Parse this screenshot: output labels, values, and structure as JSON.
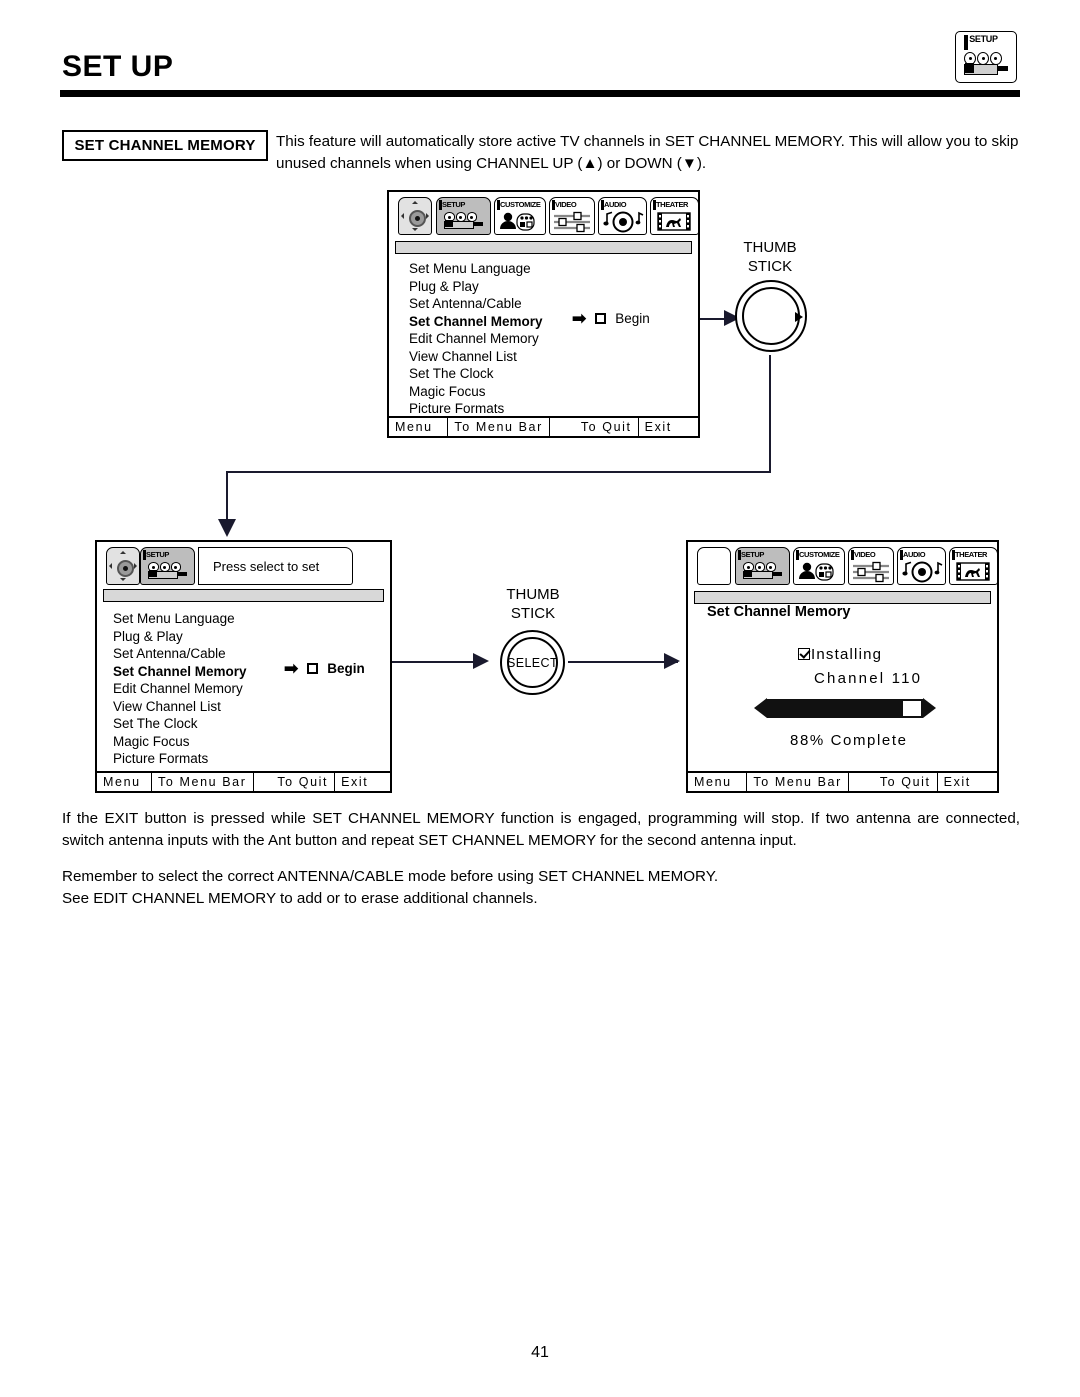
{
  "page": {
    "title": "SET UP",
    "number": "41",
    "corner_badge_icon": "setup-camera-icon"
  },
  "intro": {
    "label": "SET CHANNEL MEMORY",
    "text": "This feature will automatically store active TV channels in SET CHANNEL MEMORY.  This will allow you to skip unused channels when using CHANNEL UP (▲) or DOWN (▼)."
  },
  "tabs": [
    {
      "label": "SETUP",
      "icon": "setup-camera-icon",
      "selected": true
    },
    {
      "label": "CUSTOMIZE",
      "icon": "customize-person-icon",
      "selected": false
    },
    {
      "label": "VIDEO",
      "icon": "video-sliders-icon",
      "selected": false
    },
    {
      "label": "AUDIO",
      "icon": "audio-disc-icon",
      "selected": false
    },
    {
      "label": "THEATER",
      "icon": "theater-filmstrip-icon",
      "selected": false
    }
  ],
  "menu_items": [
    "Set Menu Language",
    "Plug & Play",
    "Set Antenna/Cable",
    "Set Channel Memory",
    "Edit Channel Memory",
    "View Channel List",
    "Set The Clock",
    "Magic Focus",
    "Picture Formats"
  ],
  "active_menu_item": "Set Channel Memory",
  "begin_row": {
    "arrow": "➡",
    "checkbox": "unchecked",
    "label": "Begin"
  },
  "footer": {
    "menu": "Menu",
    "to_menu_bar": "To Menu Bar",
    "to_quit": "To Quit",
    "exit": "Exit"
  },
  "thumbstick_top": {
    "line1": "THUMB",
    "line2": "STICK"
  },
  "thumbstick_select": {
    "line1": "THUMB",
    "line2": "STICK",
    "button": "SELECT"
  },
  "tooltip_screen": {
    "tooltip": "Press select to set"
  },
  "progress_screen": {
    "heading": "Set Channel Memory",
    "installing": "Installing",
    "channel": "Channel 110",
    "percent_text": "88% Complete",
    "percent_value": 88
  },
  "notes": {
    "para1": "If the EXIT button is pressed while SET CHANNEL MEMORY function is engaged, programming will stop.  If two antenna are connected, switch antenna inputs with the Ant button and repeat SET CHANNEL MEMORY for the second antenna input.",
    "para2_line1": "Remember to select the correct ANTENNA/CABLE mode before using SET CHANNEL MEMORY.",
    "para2_line2": "See EDIT CHANNEL MEMORY to add or to erase additional channels."
  },
  "colors": {
    "ink": "#000000",
    "line": "#1a1a2e",
    "tab_selected": "#bdbdbd",
    "menubar_strip": "#d8d8d8"
  }
}
